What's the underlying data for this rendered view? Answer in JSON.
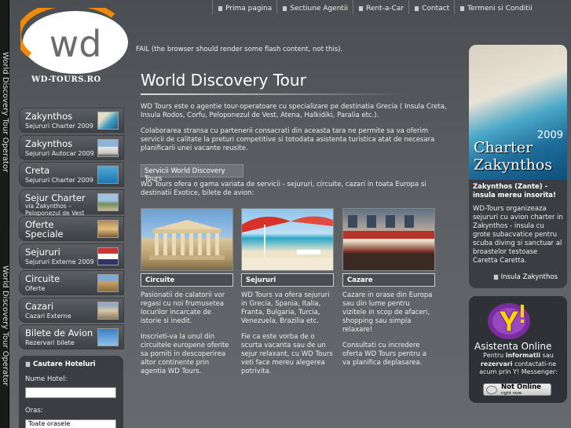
{
  "side_strip": {
    "text_top": "World Discovery Tour Operator",
    "text_bottom": "World Discovery Tour Operator"
  },
  "topnav": [
    {
      "label": "Prima pagina"
    },
    {
      "label": "Sectiune Agentii"
    },
    {
      "label": "Rent-a-Car"
    },
    {
      "label": "Contact"
    },
    {
      "label": "Termeni si Conditii"
    }
  ],
  "logo": {
    "mark": "wd",
    "subtitle": "WD-TOURS.RO"
  },
  "flash_fail": "FAIL (the browser should render some flash content, not this).",
  "menu": [
    {
      "title": "Zakynthos",
      "sub": "Sejururi Charter 2009"
    },
    {
      "title": "Zakynthos",
      "sub": "Sejururi Autocar 2009"
    },
    {
      "title": "Creta",
      "sub": "Sejururi Charter 2009"
    },
    {
      "title": "Sejur Charter",
      "sub": "via Zakynthos –",
      "sub2": "Peloponezul de Vest"
    },
    {
      "title": "Oferte",
      "title2": "Speciale"
    },
    {
      "title": "Sejururi",
      "sub": "Sejururi Externe 2009"
    },
    {
      "title": "Circuite",
      "sub": "Oferte"
    },
    {
      "title": "Cazari",
      "sub": "Cazari Externe"
    },
    {
      "title": "Bilete de Avion",
      "sub": "Rezervari bilete"
    }
  ],
  "search": {
    "title": "Cautare Hoteluri",
    "name_label": "Nume Hotel:",
    "name_value": "",
    "city_label": "Oras:",
    "city_value": "Toate orasele"
  },
  "main": {
    "title": "World Discovery Tour",
    "p1": "WD Tours este o agentie tour-operatoare cu specializare pe destinatia Grecia ( Insula Creta, Insula Rodos, Corfu, Peloponezul de Vest, Atena, Halkidiki, Paralia etc.).",
    "p2": "Colaborarea stransa cu partenerii consacrati din aceasta tara ne permite sa va oferim servicii de calitate la preturi competitive si totodata asistenta turistica atat de necesara planificarii unei vacante reusite.",
    "services_tab": "Servicii World Discovery Tours",
    "p3": "WD Tours ofera o gama variata de servicii - sejururi, circuite, cazari in toata Europa si destinatii Exotice, bilete de avion:",
    "columns": [
      {
        "caption": "Circuite",
        "text1": "Pasionatii de calatorii vor regasi cu noi frumusetea locurilor incarcate de istorie si inedit.",
        "text2": "Inscrieti-va la unul din circuitele europene oferite sa porniti in descoperirea altor continente prin agentia WD Tours."
      },
      {
        "caption": "Sejururi",
        "text1": "WD Tours va ofera sejururi in Grecia, Spania, Italia, Franta, Bulgaria, Turcia, Venezuela, Brazilia etc.",
        "text2": "Fie ca este vorba de o scurta vacanta sau de un sejur relaxant, cu WD Tours veti face mereu alegerea potrivita."
      },
      {
        "caption": "Cazare",
        "text1": "Cazare in orase din Europa sau din lume pentru vizitele in scop de afaceri, shopping sau simpla relaxare!",
        "text2": "Consultati cu incredere oferta WD Tours pentru a va planifica deplasarea."
      }
    ]
  },
  "right1": {
    "ad_line1": "Charter",
    "ad_line2": "Zakynthos",
    "ad_year": "2009",
    "title": "Zakynthos (Zante) - insula mereu insorita!",
    "text": "WD-Tours organizeaza sejururi cu avion charter in Zakynthos - insula cu grote subacvatice pentru scuba diving si sanctuar al broastelor testoase Caretta Caretta.",
    "link": "Insula Zakynthos"
  },
  "right2": {
    "title": "Asistenta Online",
    "text_a": "Pentru ",
    "text_b": "informatii",
    "text_c": " sau ",
    "text_d": "rezervari",
    "text_e": " contactati-ne acum prin Y! Messenger:",
    "status": "Not Online",
    "status_sub": "right now"
  }
}
